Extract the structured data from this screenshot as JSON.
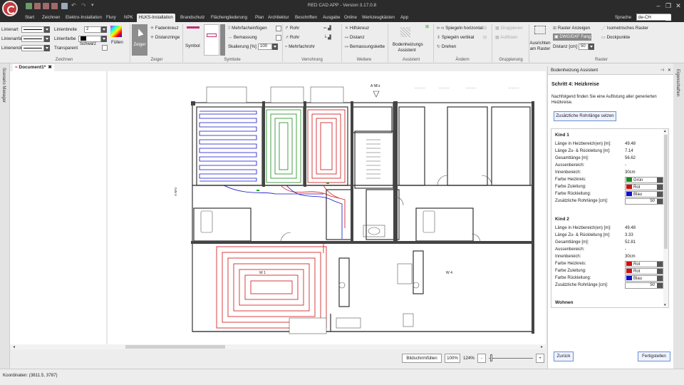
{
  "app": {
    "title": "RED CAD APP - Version 3.17.0.8"
  },
  "menu": {
    "tabs": [
      "Start",
      "Zeichnen",
      "Elektro-Installation",
      "Flury",
      "NPK",
      "HLKS-Installation",
      "Brandschutz",
      "Flächengliederung",
      "Plan",
      "Architektur",
      "Beschriften",
      "Ausgabe",
      "Online",
      "Werkzeugkästen",
      "App"
    ],
    "active_index": 5,
    "language_label": "Sprache",
    "language_value": "de-CH"
  },
  "ribbon": {
    "zeichnen": {
      "linienart": "Linienart",
      "linienbreite": "Linienbreite",
      "linienbreite_value": "2",
      "linienanfang": "Linienanfang",
      "linienfarbe": "Linienfarbe",
      "linienfarbe_value": "Schwarz",
      "linienende": "Linienende",
      "transparent": "Transparent",
      "fuellen": "Füllen",
      "group": "Zeichnen"
    },
    "zeiger": {
      "zeiger": "Zeiger",
      "fadenkreuz": "Fadenkreuz",
      "distanzringe": "Distanzringe",
      "group": "Zeiger"
    },
    "symbole": {
      "symbol": "Symbol",
      "mehrfacheinfuegen": "Mehrfacheinfügen",
      "bemassung": "Bemassung",
      "skalierung": "Skalierung [%]",
      "skalierung_value": "100",
      "group": "Symbole"
    },
    "verrohrung": {
      "rohr1": "Rohr",
      "rohr2": "Rohr",
      "mehrfachrohr": "Mehrfachrohr",
      "group": "Verrohrung"
    },
    "weitere": {
      "hilfskreuz": "Hilfskreuz",
      "distanz": "Distanz",
      "bemassungskette": "Bemassungskette",
      "group": "Weitere"
    },
    "assistent": {
      "bodenheizungs": "Bodenheizungs",
      "assistent": "Assistent",
      "group": "Assistent"
    },
    "aendern": {
      "spiegeln_h": "Spiegeln horizontal",
      "spiegeln_v": "Spiegeln vertikal",
      "drehen": "Drehen",
      "group": "Ändern"
    },
    "gruppierung": {
      "gruppieren": "Gruppieren",
      "aufloesen": "Auflösen",
      "group": "Gruppierung"
    },
    "raster": {
      "ausrichten": "Ausrichten",
      "am_raster": "am Raster",
      "raster_anzeigen": "Raster Anzeigen",
      "dwg_fang": "DWG/DXF Fang",
      "distanz": "Distanz [cm]",
      "distanz_value": "50",
      "isometrisches": "Isometrisches Raster",
      "dockpunkte": "Dockpunkte",
      "group": "Raster"
    }
  },
  "left_dock": {
    "label": "Scenario Manager"
  },
  "document": {
    "tab_label": "Document1*"
  },
  "plan": {
    "rooms": {
      "w1": "W 1",
      "w4": "W 4",
      "anfz": "A NFz",
      "anfz_side": "A NFz"
    }
  },
  "bottom": {
    "fit_button": "Bildschirmfüllen",
    "zoom_button": "100%",
    "zoom_level": "124%",
    "minus": "-",
    "plus": "+"
  },
  "panel": {
    "header": "Bodenheizung Assistent",
    "step_title": "Schritt 4: Heizkreise",
    "description": "Nachfolgend finden Sie eine Auflistung aller generierten Heizkreise.",
    "set_button": "Zusätzliche Rohrlänge setzen",
    "circuits": [
      {
        "name": "Kind 1",
        "rows": [
          {
            "label": "Länge in Heizbereich(en) [m]:",
            "value": "49.48"
          },
          {
            "label": "Länge Zu- & Rückleitung [m]:",
            "value": "7.14"
          },
          {
            "label": "Gesamtlänge [m]:",
            "value": "56.62"
          },
          {
            "label": "Aussenbereich:",
            "value": "-"
          },
          {
            "label": "Innenbereich:",
            "value": "30cm"
          }
        ],
        "farbe_heizkreis_label": "Farbe Heizkreis:",
        "farbe_heizkreis": "Grün",
        "farbe_zuleitung_label": "Farbe Zuleitung:",
        "farbe_zuleitung": "Rot",
        "farbe_rueckleitung_label": "Farbe Rückleitung:",
        "farbe_rueckleitung": "Blau",
        "zusatz_label": "Zusätzliche Rohrlänge [cm]:",
        "zusatz_value": "50"
      },
      {
        "name": "Kind 2",
        "rows": [
          {
            "label": "Länge in Heizbereich(en) [m]:",
            "value": "49.48"
          },
          {
            "label": "Länge Zu- & Rückleitung [m]:",
            "value": "3.33"
          },
          {
            "label": "Gesamtlänge [m]:",
            "value": "52.81"
          },
          {
            "label": "Aussenbereich:",
            "value": "-"
          },
          {
            "label": "Innenbereich:",
            "value": "30cm"
          }
        ],
        "farbe_heizkreis_label": "Farbe Heizkreis:",
        "farbe_heizkreis": "Rot",
        "farbe_zuleitung_label": "Farbe Zuleitung:",
        "farbe_zuleitung": "Rot",
        "farbe_rueckleitung_label": "Farbe Rückleitung:",
        "farbe_rueckleitung": "Blau",
        "zusatz_label": "Zusätzliche Rohrlänge [cm]:",
        "zusatz_value": "50"
      }
    ],
    "next_section": "Wohnen",
    "back_button": "Zurück",
    "finish_button": "Fertigstellen"
  },
  "right_dock": {
    "label": "Eigenschaften"
  },
  "status": {
    "coordinates": "Koordinaten: (3811.5, 3787)"
  },
  "colors": {
    "green": "#1a8a1a",
    "red": "#d01010",
    "blue": "#1010c8",
    "accent": "#2b2b2b"
  }
}
